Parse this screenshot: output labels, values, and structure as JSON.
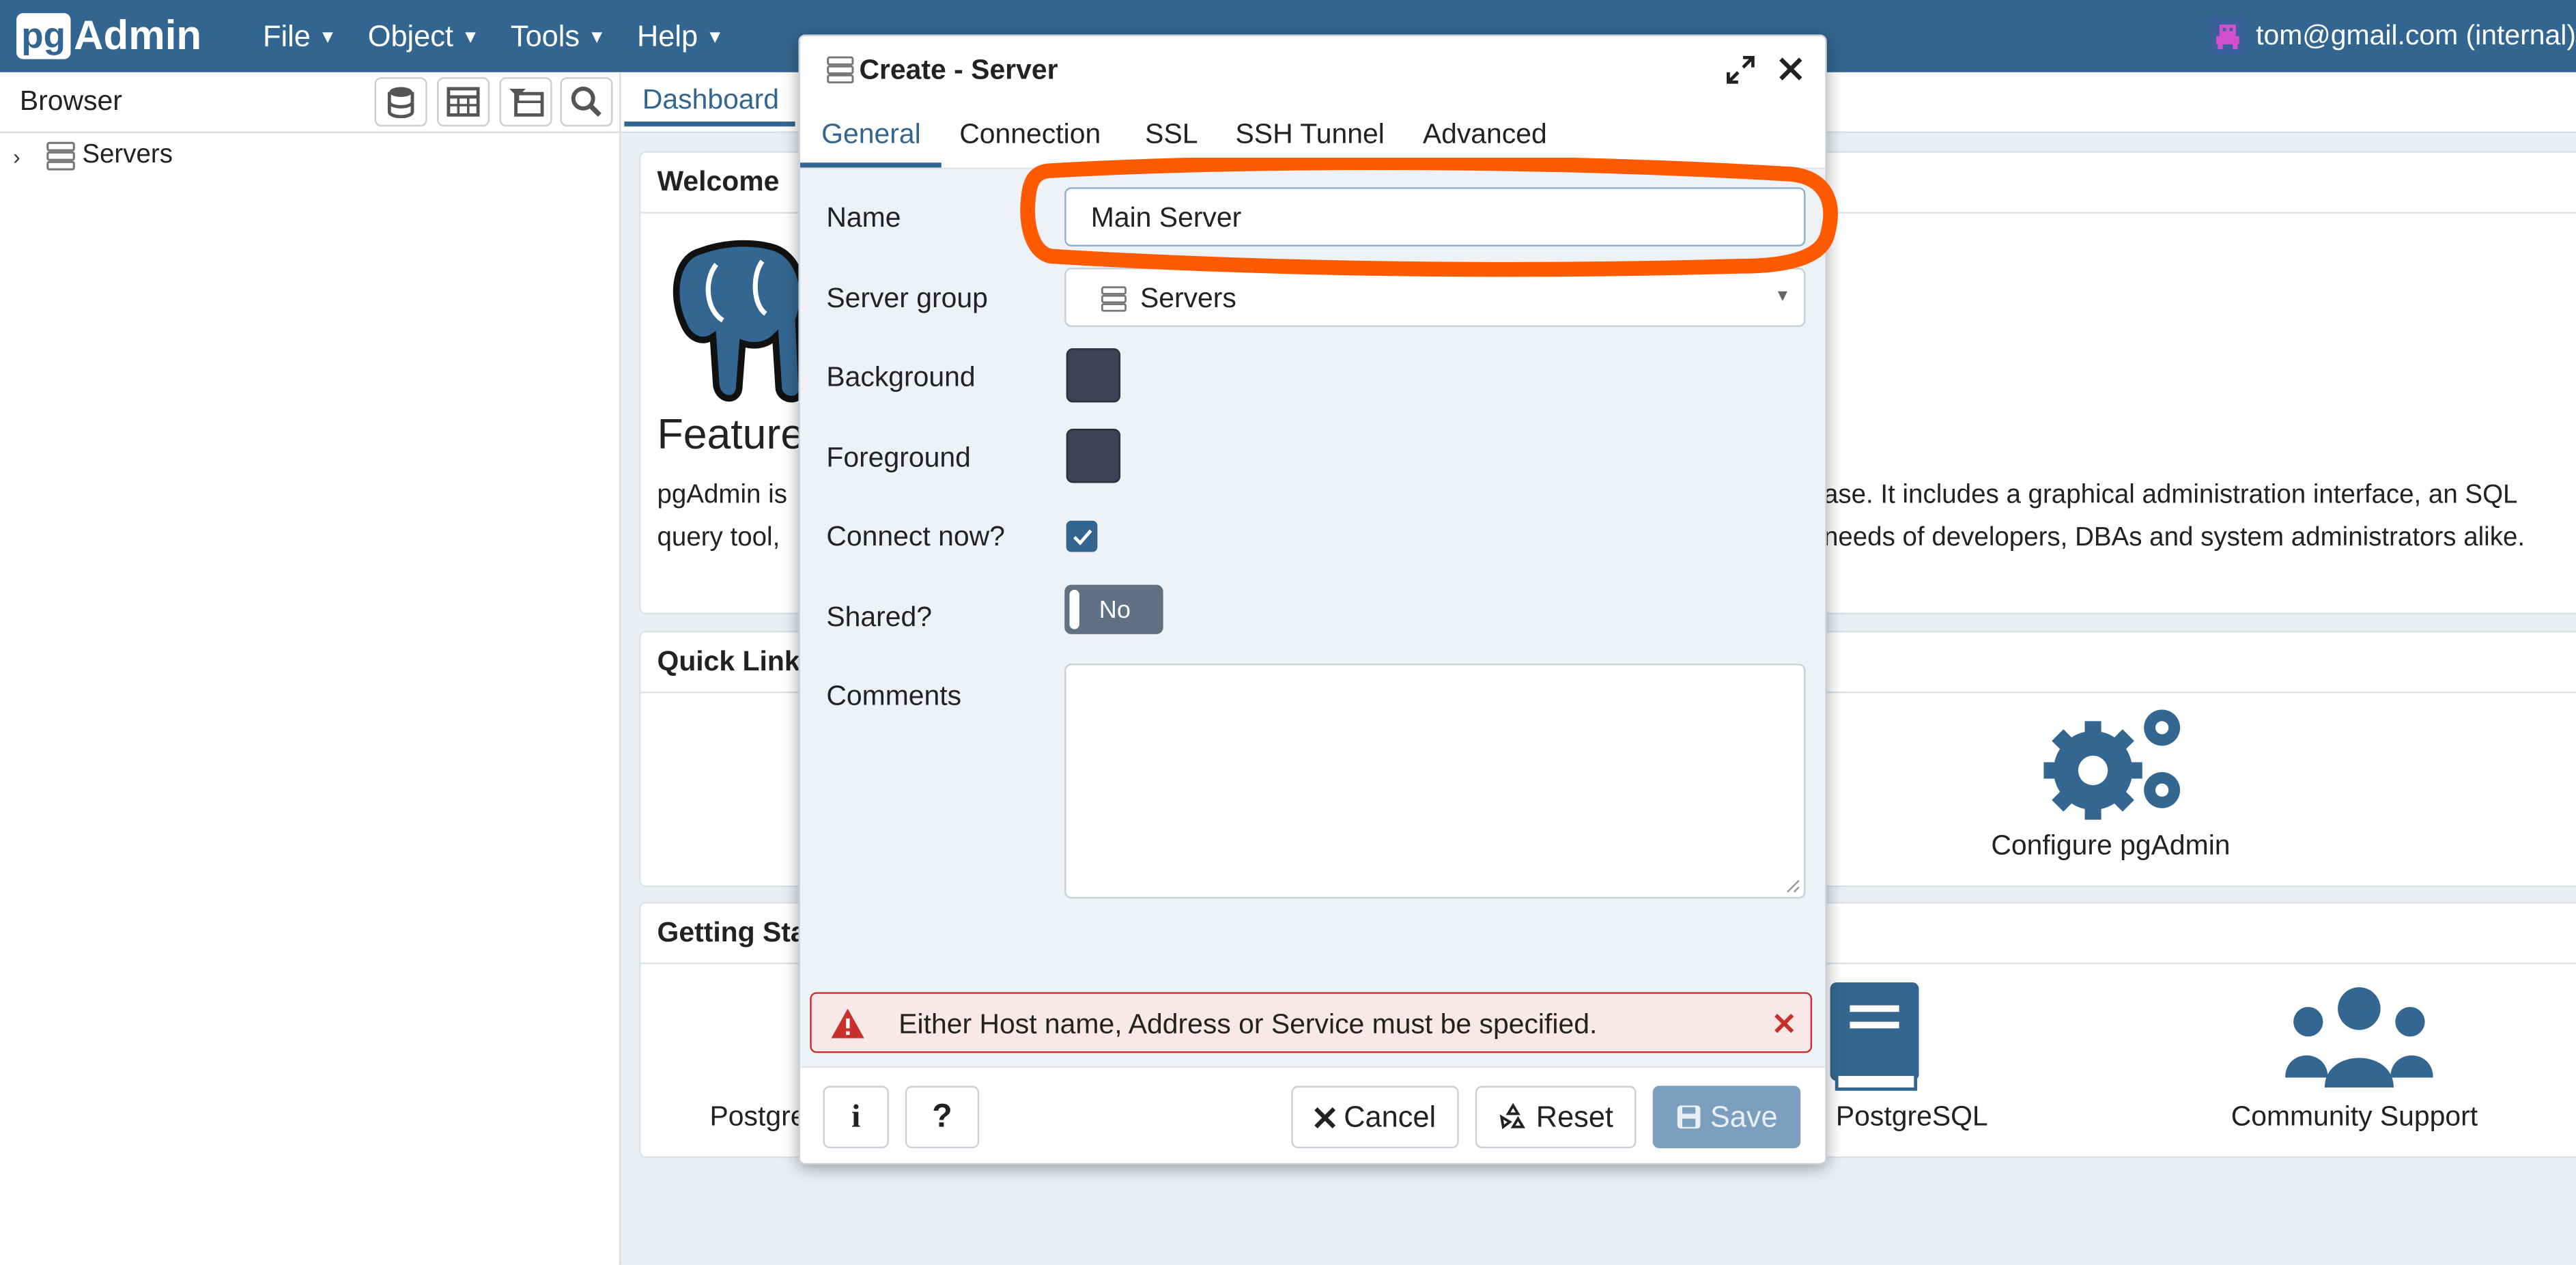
{
  "app": {
    "brand_pg": "pg",
    "brand_admin": "Admin",
    "menu": [
      {
        "label": "File"
      },
      {
        "label": "Object"
      },
      {
        "label": "Tools"
      },
      {
        "label": "Help"
      }
    ],
    "user": "tom@gmail.com (internal)"
  },
  "browser": {
    "title": "Browser",
    "tree": [
      {
        "label": "Servers"
      }
    ]
  },
  "dashboard": {
    "tab": "Dashboard",
    "welcome_title": "Welcome",
    "features_title": "Feature",
    "intro_line1_left": "pgAdmin is",
    "intro_line1_right": "ase. It includes a graphical administration interface, an SQL",
    "intro_line2_left": "query tool,",
    "intro_line2_right": "needs of developers, DBAs and system administrators alike.",
    "quick_links_title": "Quick Links",
    "configure_label": "Configure pgAdmin",
    "getting_started_title": "Getting Sta",
    "postgres_partial": "Postgre",
    "docs_partial": ": PostgreSQL",
    "community_label": "Community Support"
  },
  "dialog": {
    "title": "Create - Server",
    "tabs": [
      {
        "label": "General"
      },
      {
        "label": "Connection"
      },
      {
        "label": "SSL"
      },
      {
        "label": "SSH Tunnel"
      },
      {
        "label": "Advanced"
      }
    ],
    "fields": {
      "name_label": "Name",
      "name_value": "Main Server",
      "group_label": "Server group",
      "group_value": "Servers",
      "background_label": "Background",
      "foreground_label": "Foreground",
      "connect_label": "Connect now?",
      "connect_checked": true,
      "shared_label": "Shared?",
      "shared_value": "No",
      "comments_label": "Comments",
      "comments_value": ""
    },
    "error": "Either Host name, Address or Service must be specified.",
    "footer": {
      "info": "i",
      "help": "?",
      "cancel": "Cancel",
      "reset": "Reset",
      "save": "Save"
    }
  },
  "colors": {
    "navbar": "#326690",
    "accent": "#326690",
    "annotation": "#ff5a00",
    "error_border": "#c9302c",
    "swatch": "#3f4256"
  }
}
